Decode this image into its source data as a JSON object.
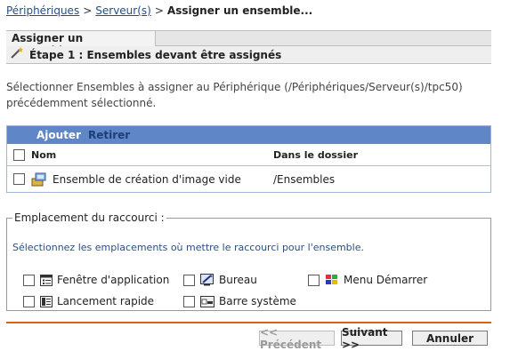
{
  "breadcrumb": {
    "items": [
      "Périphériques",
      "Serveur(s)"
    ],
    "separator": ">",
    "current": "Assigner un ensemble..."
  },
  "tab": {
    "label": "Assigner un ensemble..."
  },
  "step": {
    "title": "Étape 1 : Ensembles devant être assignés"
  },
  "description": "Sélectionner Ensembles à assigner au Périphérique (/Périphériques/Serveur(s)/tpc50) précédemment sélectionné.",
  "table": {
    "actions": {
      "add": "Ajouter",
      "remove": "Retirer"
    },
    "columns": {
      "name": "Nom",
      "folder": "Dans le dossier"
    },
    "rows": [
      {
        "name": "Ensemble de création d'image vide",
        "folder": "/Ensembles"
      }
    ]
  },
  "shortcut": {
    "legend": "Emplacement du raccourci :",
    "hint": "Sélectionnez les emplacements où mettre le raccourci pour l'ensemble.",
    "options": {
      "app_window": "Fenêtre d'application",
      "desktop": "Bureau",
      "start_menu": "Menu Démarrer",
      "quick_launch": "Lancement rapide",
      "system_tray": "Barre système"
    }
  },
  "buttons": {
    "previous": "<< Précédent",
    "next": "Suivant >>",
    "cancel": "Annuler"
  },
  "colors": {
    "action_bar": "#5f86c7",
    "link": "#1f4f8b",
    "divider": "#d0651b"
  }
}
